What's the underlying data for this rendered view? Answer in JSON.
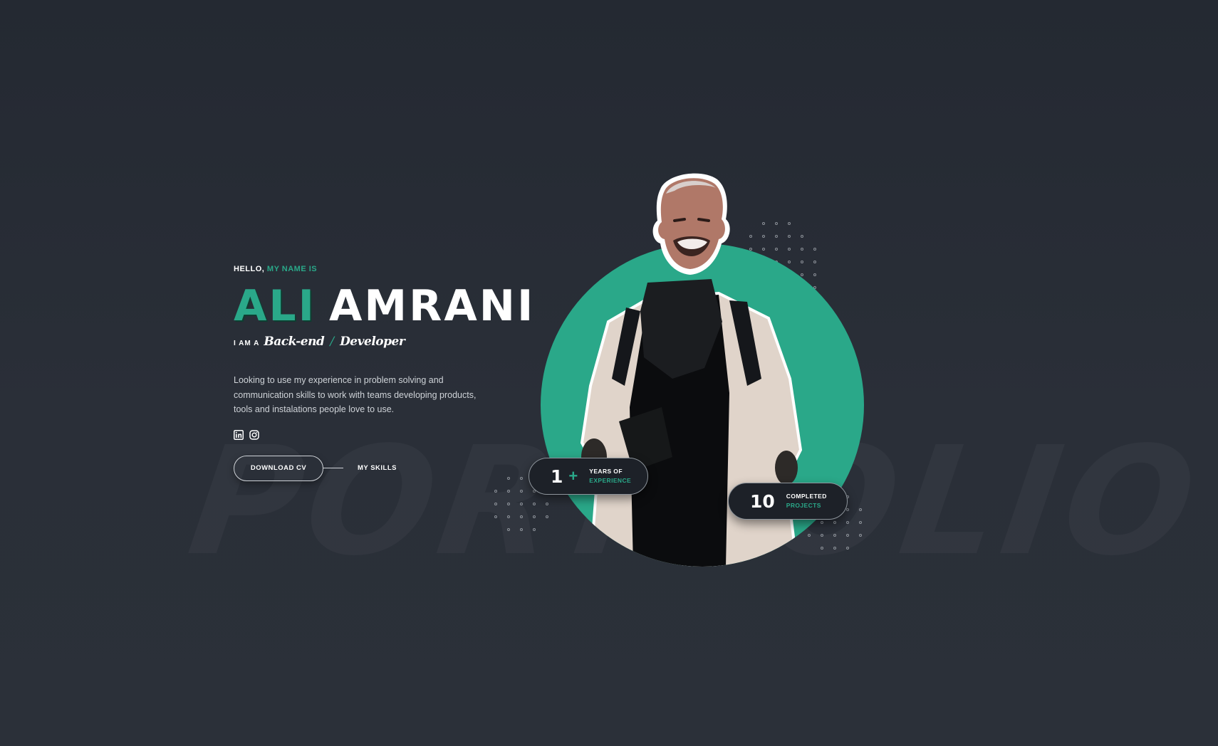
{
  "watermark": "PORTFOLIO",
  "intro": {
    "hello": "HELLO,",
    "hello_accent": "MY NAME IS",
    "first_name": "ALI",
    "last_name": "AMRANI",
    "role_prefix": "I AM A",
    "role_primary": "Back-end",
    "role_separator": "/",
    "role_secondary": "Developer",
    "bio": "Looking to use my experience in problem solving and communication skills to work with teams developing products, tools and instalations people love to use."
  },
  "socials": [
    {
      "name": "linkedin-icon"
    },
    {
      "name": "instagram-icon"
    }
  ],
  "actions": {
    "download_cv": "DOWNLOAD CV",
    "my_skills": "MY SKILLS"
  },
  "stats": {
    "experience": {
      "value": "1",
      "suffix": "+",
      "line1": "YEARS OF",
      "line2": "EXPERIENCE"
    },
    "projects": {
      "value": "10",
      "line1": "COMPLETED",
      "line2": "PROJECTS"
    }
  },
  "colors": {
    "accent": "#2aa889",
    "background": "#262b33",
    "badge_bg": "#1d2128"
  }
}
